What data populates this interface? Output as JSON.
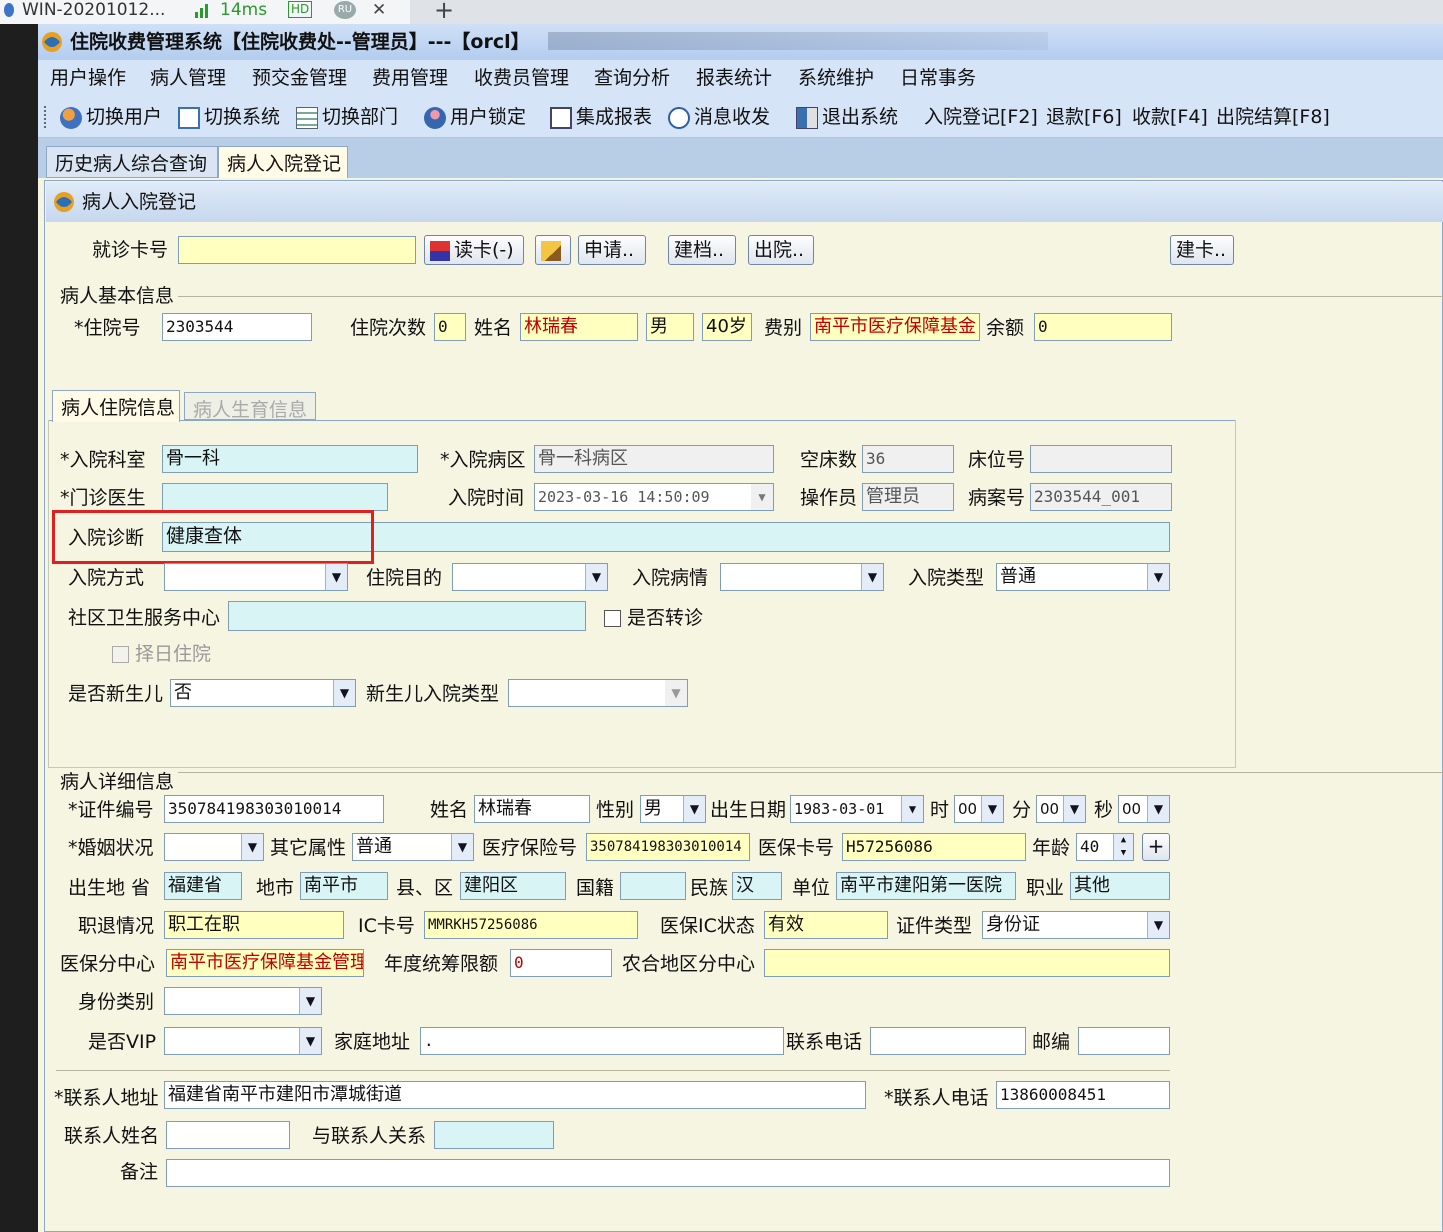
{
  "browser": {
    "tab_title": "WIN-20201012...",
    "latency": "14ms",
    "hd_badge": "HD",
    "ru_badge": "RU",
    "close": "✕",
    "new_tab": "+"
  },
  "window": {
    "title": "住院收费管理系统【住院收费处--管理员】---【orcl】"
  },
  "menu": [
    "用户操作",
    "病人管理",
    "预交金管理",
    "费用管理",
    "收费员管理",
    "查询分析",
    "报表统计",
    "系统维护",
    "日常事务"
  ],
  "toolbar": [
    "切换用户",
    "切换系统",
    "切换部门",
    "用户锁定",
    "集成报表",
    "消息收发",
    "退出系统",
    "入院登记[F2]",
    "退款[F6]",
    "收款[F4]",
    "出院结算[F8]"
  ],
  "doc_tabs": [
    "历史病人综合查询",
    "病人入院登记"
  ],
  "panel": {
    "title": "病人入院登记"
  },
  "card": {
    "label": "就诊卡号",
    "value": "",
    "read_btn": "读卡(-)",
    "apply_btn": "申请..",
    "archive_btn": "建档..",
    "discharge_btn": "出院..",
    "makecard_btn": "建卡.."
  },
  "basic": {
    "group": "病人基本信息",
    "hosp_no_label": "*住院号",
    "hosp_no": "2303544",
    "times_label": "住院次数",
    "times": "0",
    "name_label": "姓名",
    "name": "林瑞春",
    "gender": "男",
    "age": "40岁",
    "fee_label": "费别",
    "fee": "南平市医疗保障基金",
    "balance_label": "余额",
    "balance": "0"
  },
  "inner_tabs": [
    "病人住院信息",
    "病人生育信息"
  ],
  "inpatient": {
    "dept_label": "*入院科室",
    "dept": "骨一科",
    "ward_label": "*入院病区",
    "ward": "骨一科病区",
    "empty_beds_label": "空床数",
    "empty_beds": "36",
    "bed_label": "床位号",
    "bed": "",
    "doctor_label": "*门诊医生",
    "doctor": "",
    "time_label": "入院时间",
    "time": "2023-03-16 14:50:09",
    "operator_label": "操作员",
    "operator": "管理员",
    "case_label": "病案号",
    "case_no": "2303544_001",
    "diag_label": "入院诊断",
    "diag": "健康查体",
    "mode_label": "入院方式",
    "mode": "",
    "purpose_label": "住院目的",
    "purpose": "",
    "cond_label": "入院病情",
    "cond": "",
    "type_label": "入院类型",
    "type": "普通",
    "community_label": "社区卫生服务中心",
    "community": "",
    "transfer_label": "是否转诊",
    "choose_day_label": "择日住院",
    "newborn_label": "是否新生儿",
    "newborn": "否",
    "newborn_type_label": "新生儿入院类型",
    "newborn_type": ""
  },
  "detail": {
    "group": "病人详细信息",
    "id_label": "*证件编号",
    "id_no": "350784198303010014",
    "name_label": "姓名",
    "name": "林瑞春",
    "gender_label": "性别",
    "gender": "男",
    "birth_label": "出生日期",
    "birth": "1983-03-01",
    "hour_label": "时",
    "hour": "00",
    "min_label": "分",
    "min": "00",
    "sec_label": "秒",
    "sec": "00",
    "marriage_label": "*婚姻状况",
    "marriage": "",
    "other_label": "其它属性",
    "other": "普通",
    "insure_label": "医疗保险号",
    "insure_no": "350784198303010014",
    "card_label": "医保卡号",
    "card_no": "H57256086",
    "age_label": "年龄",
    "age": "40",
    "province_label": "出生地 省",
    "province": "福建省",
    "city_label": "地市",
    "city": "南平市",
    "county_label": "县、区",
    "county": "建阳区",
    "nation_label": "国籍",
    "nation": "",
    "ethnic_label": "民族",
    "ethnic": "汉",
    "unit_label": "单位",
    "unit": "南平市建阳第一医院",
    "job_label": "职业",
    "job": "其他",
    "retire_label": "职退情况",
    "retire": "职工在职",
    "ic_label": "IC卡号",
    "ic": "MMRKH57256086",
    "icstate_label": "医保IC状态",
    "icstate": "有效",
    "certtype_label": "证件类型",
    "certtype": "身份证",
    "center_label": "医保分中心",
    "center": "南平市医疗保障基金管理中心",
    "limit_label": "年度统筹限额",
    "limit": "0",
    "rural_label": "农合地区分中心",
    "rural": "",
    "identity_label": "身份类别",
    "identity": "",
    "vip_label": "是否VIP",
    "vip": "",
    "addr_label": "家庭地址",
    "addr": ".",
    "phone_label": "联系电话",
    "phone": "",
    "zip_label": "邮编",
    "zip": "",
    "contact_addr_label": "*联系人地址",
    "contact_addr": "福建省南平市建阳市潭城街道",
    "contact_phone_label": "*联系人电话",
    "contact_phone": "13860008451",
    "contact_name_label": "联系人姓名",
    "contact_name": "",
    "relation_label": "与联系人关系",
    "relation": "",
    "remark_label": "备注",
    "remark": ""
  },
  "colors": {
    "highlight_box": "#e02020",
    "title_bar": "#b3cdef",
    "panel_bg": "#f5f5e2",
    "yellow_field": "#ffffc0",
    "cyan_field": "#d8f4f4"
  }
}
